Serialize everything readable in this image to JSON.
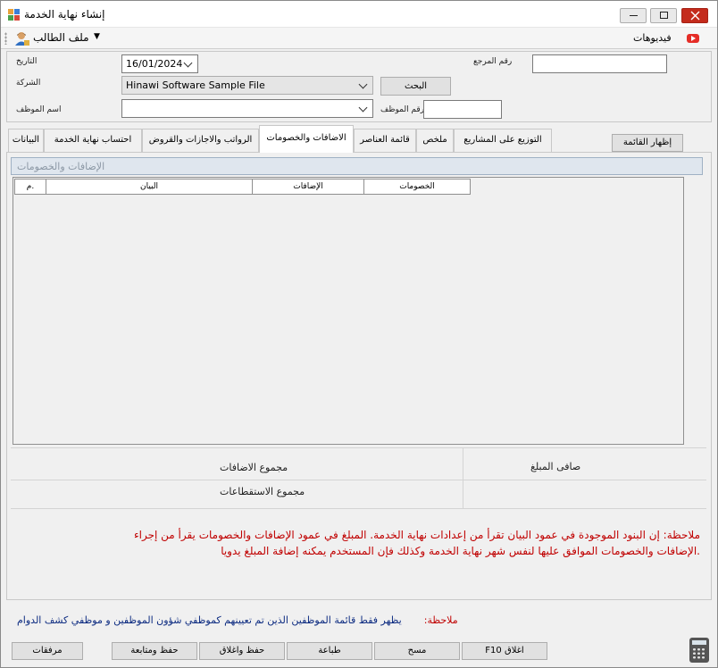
{
  "window": {
    "title": "إنشاء نهاية الخدمة"
  },
  "menu": {
    "student_file": "ملف الطالب",
    "videos": "فيديوهات"
  },
  "header": {
    "date_label": "التاريخ",
    "date_value": "16/01/2024",
    "reference_label": "رقم المرجع",
    "reference_value": "",
    "company_label": "الشركة",
    "company_value": "Hinawi Software Sample File",
    "search_button": "البحث",
    "employee_name_label": "اسم الموظف",
    "employee_name_value": "",
    "employee_number_label": "رقم الموظف",
    "employee_number_value": ""
  },
  "tabs": [
    {
      "label": "البيانات"
    },
    {
      "label": "احتساب نهاية الخدمة"
    },
    {
      "label": "الرواتب والاجازات والقروض"
    },
    {
      "label": "الاضافات والخصومات",
      "active": true
    },
    {
      "label": "قائمة العناصر"
    },
    {
      "label": "ملخص"
    },
    {
      "label": "التوزيع على المشاريع"
    }
  ],
  "show_list_button": "إظهار القائمة",
  "panel": {
    "group_title": "الإضافات والخصومات",
    "columns": [
      "م.",
      "البيان",
      "الإضافات",
      "الخصومات"
    ],
    "rows": [],
    "total_additions": "مجموع الاضافات",
    "total_deductions": "مجموع الاستقطاعات",
    "net_amount": "صافى المبلغ",
    "note_line1": "ملاحظة: إن البنود الموجودة في عمود البيان تقرأ من إعدادات نهاية الخدمة. المبلغ في عمود الإضافات والخصومات يقرأ من إجراء",
    "note_line2": ".الإضافات والخصومات الموافق عليها لنفس شهر نهاية الخدمة وكذلك فإن المستخدم يمكنه إضافة المبلغ يدويا"
  },
  "bottom": {
    "note_label": "ملاحظة:",
    "note_text": "يظهر فقط قائمة الموظفين الذين تم تعيينهم كموظفي شؤون الموظفين و موظفي كشف الدوام",
    "buttons": {
      "close": "F10 اغلاق",
      "clear": "مسح",
      "print": "طباعة",
      "save_close": "حفظ واغلاق",
      "save_continue": "حفظ ومتابعة",
      "attachments": "مرفقات"
    }
  },
  "colors": {
    "note_red": "#c00000",
    "note_blue": "#0b2a80",
    "close_button": "#c42b1c",
    "group_header_bg": "#dfe6ee"
  }
}
